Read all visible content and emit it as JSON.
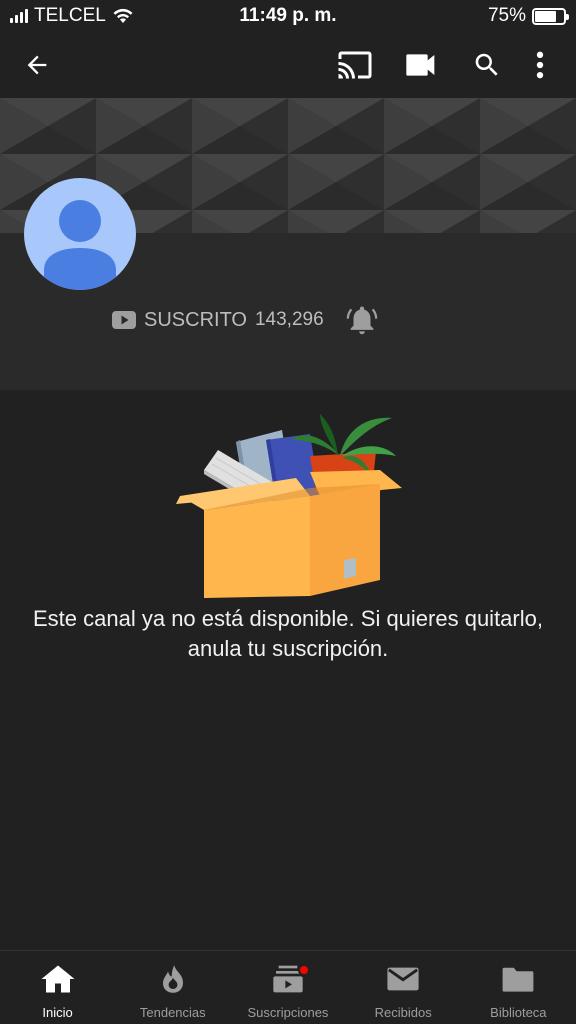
{
  "status_bar": {
    "carrier": "TELCEL",
    "time": "11:49 p. m.",
    "battery_percent": "75%",
    "battery_level": 0.75
  },
  "app_bar": {
    "icons": [
      "back-arrow-icon",
      "cast-icon",
      "video-camera-icon",
      "search-icon",
      "more-vert-icon"
    ]
  },
  "channel": {
    "subscribed_label": "SUSCRITO",
    "subscriber_count": "143,296"
  },
  "empty_state": {
    "message": "Este canal ya no está disponible. Si quieres quitarlo, anula tu suscripción."
  },
  "bottom_nav": {
    "items": [
      {
        "label": "Inicio",
        "icon": "home-icon",
        "active": true
      },
      {
        "label": "Tendencias",
        "icon": "flame-icon",
        "active": false
      },
      {
        "label": "Suscripciones",
        "icon": "subscriptions-icon",
        "active": false
      },
      {
        "label": "Recibidos",
        "icon": "mail-icon",
        "active": false
      },
      {
        "label": "Biblioteca",
        "icon": "folder-icon",
        "active": false
      }
    ]
  },
  "colors": {
    "background": "#212121",
    "header_bg": "#2a2a2a",
    "avatar_bg": "#a8c7fa",
    "avatar_figure": "#4a7ee0",
    "notification_dot": "#ff0000"
  }
}
